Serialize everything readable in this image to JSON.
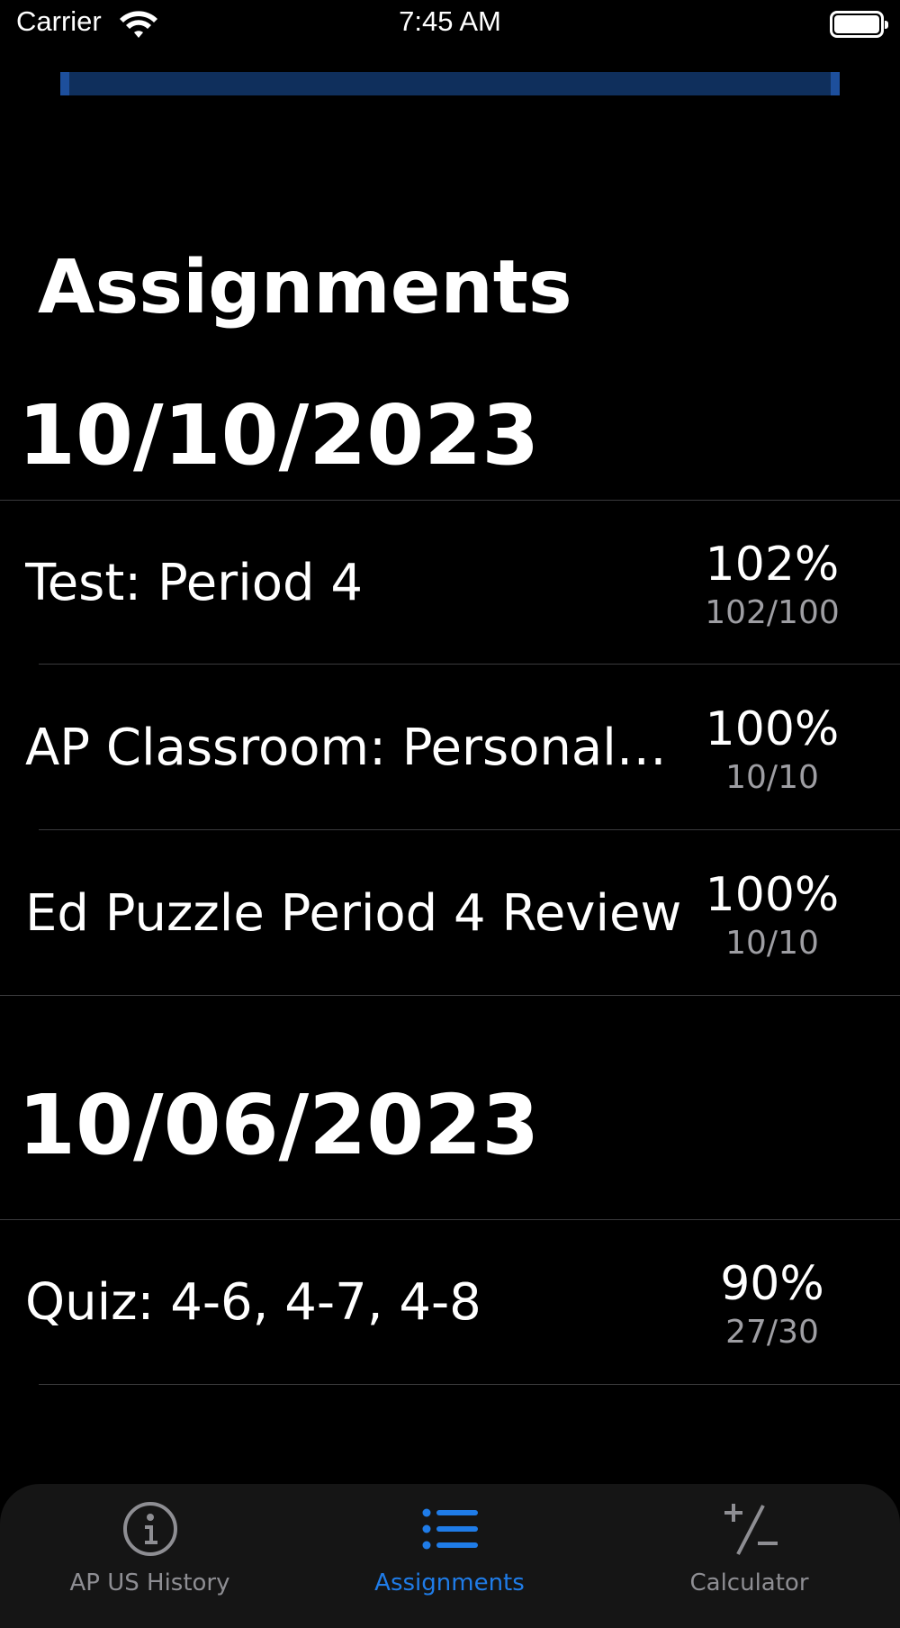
{
  "status_bar": {
    "carrier": "Carrier",
    "time": "7:45 AM"
  },
  "page_title": "Assignments",
  "sections": [
    {
      "date": "10/10/2023",
      "items": [
        {
          "title": "Test: Period 4",
          "percent": "102%",
          "score": "102/100"
        },
        {
          "title": "AP Classroom: Personal…",
          "percent": "100%",
          "score": "10/10"
        },
        {
          "title": "Ed Puzzle Period 4 Review",
          "percent": "100%",
          "score": "10/10"
        }
      ]
    },
    {
      "date": "10/06/2023",
      "items": [
        {
          "title": "Quiz: 4-6, 4-7, 4-8",
          "percent": "90%",
          "score": "27/30"
        }
      ]
    }
  ],
  "tab_bar": {
    "tabs": [
      {
        "label": "AP US History",
        "icon": "info-icon",
        "active": false
      },
      {
        "label": "Assignments",
        "icon": "list-icon",
        "active": true
      },
      {
        "label": "Calculator",
        "icon": "plus-minus-icon",
        "active": false
      }
    ]
  },
  "colors": {
    "accent": "#1f7ce8",
    "background": "#000000",
    "secondary_text": "#9e9ea3"
  }
}
